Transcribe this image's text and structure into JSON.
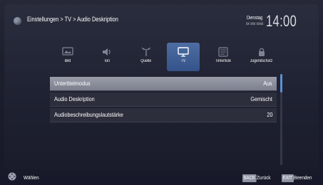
{
  "header": {
    "breadcrumb": "Einstellungen > TV > Audio Deskription",
    "day": "Dienstag",
    "date": "xx xxx xxxx",
    "time": "14:00"
  },
  "tabs": [
    {
      "label": "Bild",
      "icon": "picture-icon"
    },
    {
      "label": "Ton",
      "icon": "speaker-icon"
    },
    {
      "label": "Quelle",
      "icon": "antenna-icon"
    },
    {
      "label": "TV",
      "icon": "tv-icon",
      "active": true
    },
    {
      "label": "Timerliste",
      "icon": "timer-list-icon"
    },
    {
      "label": "Jugendschutz",
      "icon": "parental-lock-icon"
    }
  ],
  "list": [
    {
      "key": "Untertitelmodus",
      "value": "Aus",
      "selected": true
    },
    {
      "key": "Audio Deskription",
      "value": "Gemischt"
    },
    {
      "key": "Audiobeschreibungslautstärke",
      "value": "20"
    }
  ],
  "footer": {
    "select_label": "Wählen",
    "back_key": "BACK",
    "back_label": "Zurück",
    "exit_key": "EXIT",
    "exit_label": "Beenden"
  },
  "colors": {
    "accent": "#4e6da3",
    "selected_row": "#8c8f9c",
    "scroll_thumb": "#5b8fd3"
  }
}
